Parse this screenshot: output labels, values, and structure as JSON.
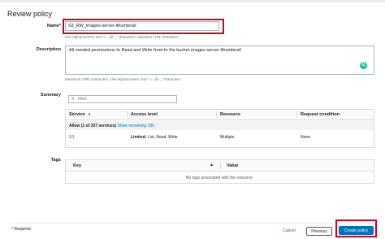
{
  "page": {
    "title": "Review policy"
  },
  "name": {
    "label": "Name*",
    "value": "S3_RW_images-server-lthumbnail",
    "hint": "Use alphanumeric and '+=,.@-_' characters. Maximum 128 characters."
  },
  "description": {
    "label": "Description",
    "value": "All needed permissions to Read and Write from-to the bucket images-server-lthumbnail",
    "hint": "Maximum 1000 characters. Use alphanumeric and '+=,.@-_' characters."
  },
  "summary": {
    "label": "Summary",
    "filter_placeholder": "Filter",
    "columns": {
      "service": "Service",
      "access": "Access level",
      "resource": "Resource",
      "condition": "Request condition"
    },
    "allow_label": "Allow (1 of 337 services)",
    "show_remaining": "Show remaining 336",
    "rows": [
      {
        "service": "S3",
        "access_bold": "Limited:",
        "access_rest": " List, Read, Write",
        "resource": "Multiple",
        "condition": "None"
      }
    ]
  },
  "tags": {
    "label": "Tags",
    "columns": {
      "key": "Key",
      "value": "Value"
    },
    "empty": "No tags associated with the resource."
  },
  "footer": {
    "required": "* Required",
    "cancel": "Cancel",
    "previous": "Previous",
    "create": "Create policy"
  },
  "colors": {
    "accent": "#0073bb",
    "highlight": "#d0021b"
  }
}
